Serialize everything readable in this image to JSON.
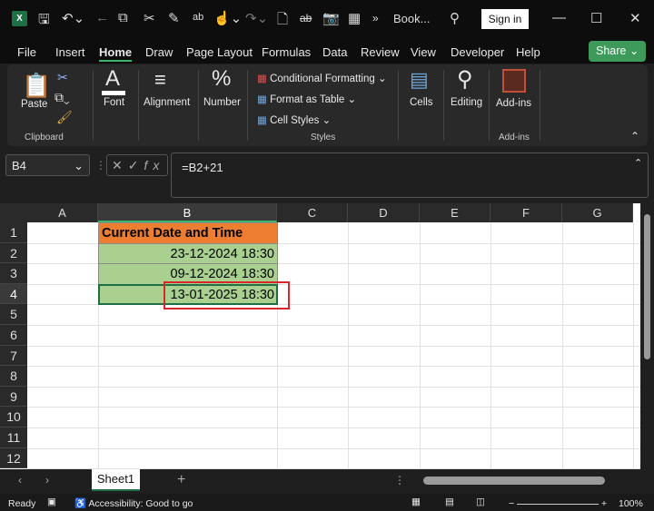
{
  "titlebar": {
    "doc_title": "Book...",
    "sign_in": "Sign in",
    "overflow": "»"
  },
  "menu": {
    "items": [
      "File",
      "Insert",
      "Home",
      "Draw",
      "Page Layout",
      "Formulas",
      "Data",
      "Review",
      "View",
      "Developer",
      "Help"
    ],
    "share": "Share"
  },
  "ribbon": {
    "paste": "Paste",
    "clipboard": "Clipboard",
    "font": "Font",
    "alignment": "Alignment",
    "number": "Number",
    "conditional_formatting": "Conditional Formatting",
    "format_as_table": "Format as Table",
    "cell_styles": "Cell Styles",
    "styles": "Styles",
    "cells": "Cells",
    "editing": "Editing",
    "addins": "Add-ins",
    "addins_group": "Add-ins"
  },
  "formula_bar": {
    "name_box": "B4",
    "fx": "fx",
    "formula": "=B2+21"
  },
  "sheet": {
    "columns": [
      "A",
      "B",
      "C",
      "D",
      "E",
      "F",
      "G"
    ],
    "rows": [
      "1",
      "2",
      "3",
      "4",
      "5",
      "6",
      "7",
      "8",
      "9",
      "10",
      "11",
      "12"
    ],
    "cells": {
      "B1": "Current Date and Time",
      "B2": "23-12-2024 18:30",
      "B3": "09-12-2024 18:30",
      "B4": "13-01-2025 18:30"
    },
    "header_fill": "#ed7d31",
    "data_fill": "#a9d08e",
    "highlight_border": "#d9262b"
  },
  "tabs": {
    "sheet1": "Sheet1",
    "add": "+"
  },
  "status": {
    "ready": "Ready",
    "accessibility": "Accessibility: Good to go",
    "zoom": "100%"
  }
}
